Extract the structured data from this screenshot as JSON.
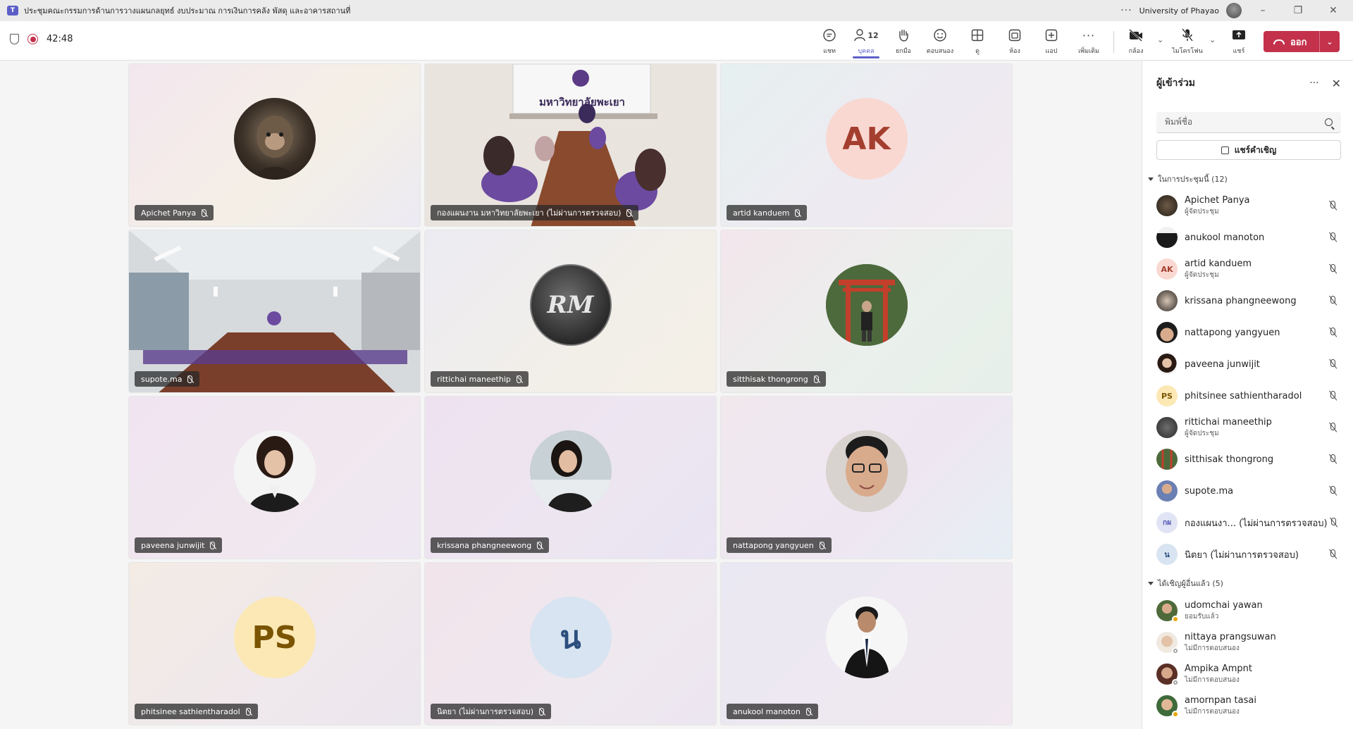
{
  "window": {
    "title": "ประชุมคณะกรรมการด้านการวางแผนกลยุทธ์ งบประมาณ การเงินการคลัง พัสดุ และอาคารสถานที่",
    "organization": "University of Phayao",
    "more": "···"
  },
  "toolbar": {
    "timer": "42:48",
    "people_count": "12",
    "items": [
      {
        "label": "แชท",
        "icon": "chat-icon"
      },
      {
        "label": "บุคคล",
        "icon": "people-icon"
      },
      {
        "label": "ยกมือ",
        "icon": "raise-hand-icon"
      },
      {
        "label": "ตอบสนอง",
        "icon": "react-icon"
      },
      {
        "label": "ดู",
        "icon": "view-icon"
      },
      {
        "label": "ห้อง",
        "icon": "rooms-icon"
      },
      {
        "label": "แอป",
        "icon": "apps-icon"
      },
      {
        "label": "เพิ่มเติม",
        "icon": "more-icon"
      },
      {
        "label": "กล้อง",
        "icon": "camera-off-icon"
      },
      {
        "label": "ไมโครโฟน",
        "icon": "mic-off-icon"
      },
      {
        "label": "แชร์",
        "icon": "share-icon"
      }
    ],
    "leave_label": "ออก"
  },
  "tiles": [
    {
      "name": "Apichet Panya",
      "avatar": "photo-monkey-king"
    },
    {
      "name": "กองแผนงาน มหาวิทยาลัยพะเยา (ไม่ผ่านการตรวจสอบ)",
      "video_sign": "มหาวิทยาลัยพะเยา"
    },
    {
      "name": "artid kanduem",
      "initials": "AK"
    },
    {
      "name": "supote.ma"
    },
    {
      "name": "rittichai maneethip",
      "initials": "RM"
    },
    {
      "name": "sitthisak thongrong"
    },
    {
      "name": "paveena junwijit"
    },
    {
      "name": "krissana phangneewong"
    },
    {
      "name": "nattapong yangyuen"
    },
    {
      "name": "phitsinee sathientharadol",
      "initials": "PS"
    },
    {
      "name": "นิตยา (ไม่ผ่านการตรวจสอบ)",
      "initials": "น"
    },
    {
      "name": "anukool manoton"
    }
  ],
  "panel": {
    "title": "ผู้เข้าร่วม",
    "search_placeholder": "พิมพ์ชื่อ",
    "invite_label": "แชร์คำเชิญ",
    "in_meeting_header": "ในการประชุมนี้ (12)",
    "in_meeting": [
      {
        "name": "Apichet Panya",
        "role": "ผู้จัดประชุม"
      },
      {
        "name": "anukool manoton",
        "role": ""
      },
      {
        "name": "artid kanduem",
        "role": "ผู้จัดประชุม",
        "initials": "AK"
      },
      {
        "name": "krissana phangneewong",
        "role": ""
      },
      {
        "name": "nattapong yangyuen",
        "role": ""
      },
      {
        "name": "paveena junwijit",
        "role": ""
      },
      {
        "name": "phitsinee sathientharadol",
        "role": "",
        "initials": "PS"
      },
      {
        "name": "rittichai maneethip",
        "role": "ผู้จัดประชุม"
      },
      {
        "name": "sitthisak thongrong",
        "role": ""
      },
      {
        "name": "supote.ma",
        "role": ""
      },
      {
        "name": "กองแผนงา... (ไม่ผ่านการตรวจสอบ)",
        "role": "",
        "initials": "กผ"
      },
      {
        "name": "นิตยา (ไม่ผ่านการตรวจสอบ)",
        "role": "",
        "initials": "น"
      }
    ],
    "invited_header": "ได้เชิญผู้อื่นแล้ว (5)",
    "invited": [
      {
        "name": "udomchai yawan",
        "status": "ยอมรับแล้ว"
      },
      {
        "name": "nittaya prangsuwan",
        "status": "ไม่มีการตอบสนอง"
      },
      {
        "name": "Ampika Ampnt",
        "status": "ไม่มีการตอบสนอง"
      },
      {
        "name": "amornpan tasai",
        "status": "ไม่มีการตอบสนอง"
      }
    ]
  }
}
